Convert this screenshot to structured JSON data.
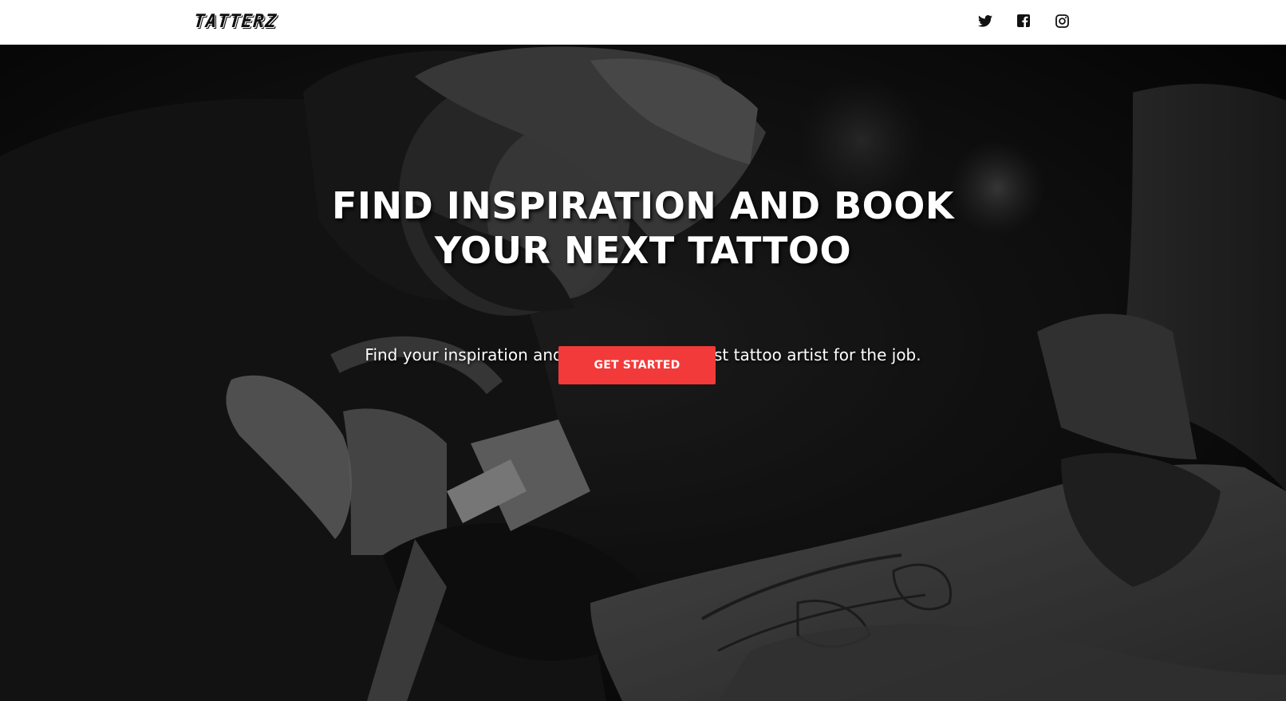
{
  "header": {
    "logo_text": "TATTERZ",
    "social": [
      {
        "name": "twitter",
        "icon": "twitter-icon"
      },
      {
        "name": "facebook",
        "icon": "facebook-icon"
      },
      {
        "name": "instagram",
        "icon": "instagram-icon"
      }
    ]
  },
  "hero": {
    "title_line1": "FIND INSPIRATION AND BOOK",
    "title_line2": "YOUR NEXT TATTOO",
    "subtitle": "Find your inspiration and we will find the best tattoo artist for the job.",
    "cta_label": "GET STARTED",
    "background": "black-and-white photo of a tattoo artist tattooing a client's forearm"
  },
  "colors": {
    "header_bg": "#ffffff",
    "accent": "#f23a3a",
    "hero_text": "#ffffff"
  }
}
